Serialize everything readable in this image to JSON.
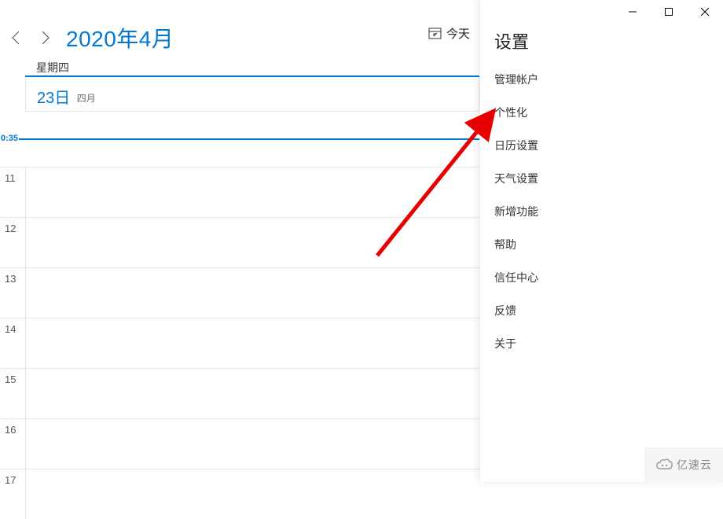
{
  "title_bar": {
    "minimize": "minimize",
    "maximize": "maximize",
    "close": "close"
  },
  "header": {
    "month_title": "2020年4月",
    "today_label": "今天"
  },
  "day": {
    "weekday_label": "星期四",
    "date_number": "23日",
    "date_month": "四月"
  },
  "timeline": {
    "now_label": "0:35",
    "hours": [
      "11",
      "12",
      "13",
      "14",
      "15",
      "16",
      "17"
    ]
  },
  "settings": {
    "title": "设置",
    "items": [
      "管理帐户",
      "个性化",
      "日历设置",
      "天气设置",
      "新增功能",
      "帮助",
      "信任中心",
      "反馈",
      "关于"
    ]
  },
  "watermark": {
    "text": "亿速云"
  }
}
